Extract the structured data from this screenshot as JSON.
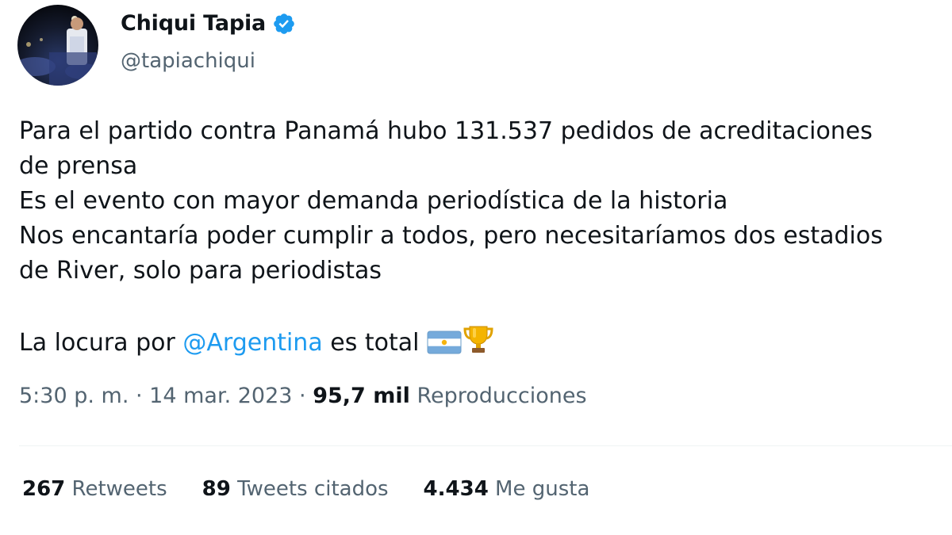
{
  "user": {
    "display_name": "Chiqui Tapia",
    "handle": "@tapiachiqui",
    "verified": true,
    "avatar_icon": "profile-photo"
  },
  "tweet": {
    "lines": [
      "Para el partido contra Panamá hubo 131.537 pedidos de acreditaciones",
      "de prensa",
      "Es el evento con mayor demanda periodística de la historia",
      "Nos encantaría poder cumplir a todos, pero necesitaríamos dos estadios",
      "de River, solo para periodistas"
    ],
    "last_line_prefix": "La locura por ",
    "mention": "@Argentina",
    "last_line_suffix": " es total ",
    "emojis": [
      "argentina-flag-icon",
      "trophy-icon"
    ]
  },
  "meta": {
    "time": "5:30 p. m.",
    "separator": " · ",
    "date": "14 mar. 2023",
    "views_count": "95,7 mil",
    "views_label": " Reproducciones"
  },
  "stats": {
    "retweets_count": "267",
    "retweets_label": " Retweets",
    "quotes_count": "89",
    "quotes_label": " Tweets citados",
    "likes_count": "4.434",
    "likes_label": " Me gusta"
  },
  "colors": {
    "text": "#0f1419",
    "secondary": "#536471",
    "link": "#1d9bf0",
    "divider": "#eff3f4"
  }
}
